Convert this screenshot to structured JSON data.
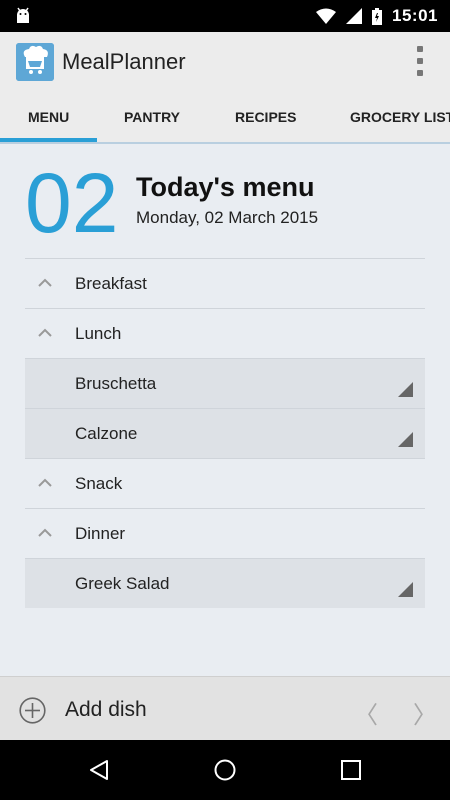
{
  "status_bar": {
    "time": "15:01"
  },
  "app": {
    "title": "MealPlanner"
  },
  "tabs": [
    {
      "label": "MENU",
      "active": true
    },
    {
      "label": "PANTRY",
      "active": false
    },
    {
      "label": "RECIPES",
      "active": false
    },
    {
      "label": "GROCERY LIST",
      "active": false
    }
  ],
  "header": {
    "day_number": "02",
    "title": "Today's menu",
    "date": "Monday, 02 March 2015"
  },
  "meals": [
    {
      "label": "Breakfast",
      "type": "meal"
    },
    {
      "label": "Lunch",
      "type": "meal"
    },
    {
      "label": "Bruschetta",
      "type": "dish"
    },
    {
      "label": "Calzone",
      "type": "dish"
    },
    {
      "label": "Snack",
      "type": "meal"
    },
    {
      "label": "Dinner",
      "type": "meal"
    },
    {
      "label": "Greek Salad",
      "type": "dish"
    }
  ],
  "bottom_bar": {
    "add_label": "Add dish",
    "prev_glyph": "〈",
    "next_glyph": "〉"
  },
  "colors": {
    "accent": "#2a9fd6",
    "background": "#e9edf2"
  }
}
